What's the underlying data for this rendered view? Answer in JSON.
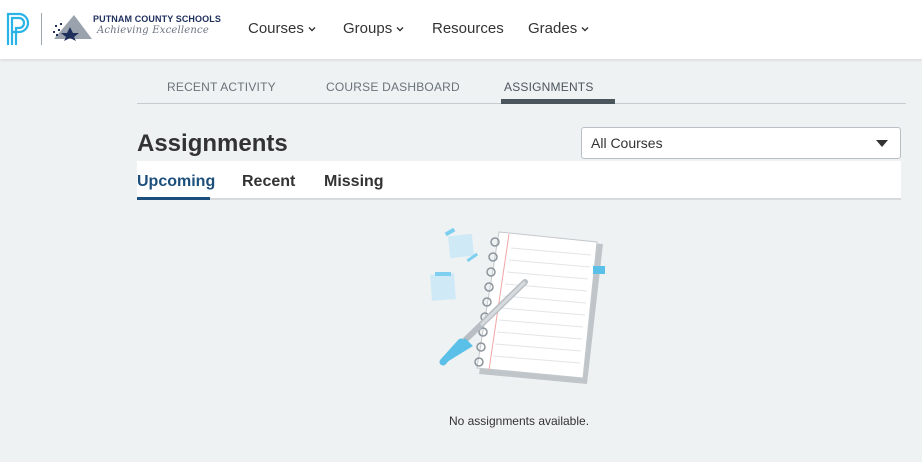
{
  "header": {
    "school_name": "PUTNAM COUNTY SCHOOLS",
    "school_motto": "Achieving Excellence",
    "nav": [
      {
        "label": "Courses",
        "has_dropdown": true
      },
      {
        "label": "Groups",
        "has_dropdown": true
      },
      {
        "label": "Resources",
        "has_dropdown": false
      },
      {
        "label": "Grades",
        "has_dropdown": true
      }
    ]
  },
  "page_tabs": [
    {
      "label": "RECENT ACTIVITY",
      "active": false
    },
    {
      "label": "COURSE DASHBOARD",
      "active": false
    },
    {
      "label": "ASSIGNMENTS",
      "active": true
    }
  ],
  "main": {
    "title": "Assignments",
    "course_filter": {
      "selected": "All Courses"
    },
    "subtabs": [
      {
        "label": "Upcoming",
        "active": true
      },
      {
        "label": "Recent",
        "active": false
      },
      {
        "label": "Missing",
        "active": false
      }
    ],
    "empty_message": "No assignments available."
  },
  "colors": {
    "background": "#eff2f3",
    "accent_blue": "#1d4f7c",
    "logo_cyan": "#2ab3e6",
    "tab_active": "#4b555c"
  },
  "icons": [
    "powerschool-p-icon",
    "school-logo-icon",
    "chevron-down-icon",
    "caret-down-icon",
    "notebook-illustration"
  ]
}
